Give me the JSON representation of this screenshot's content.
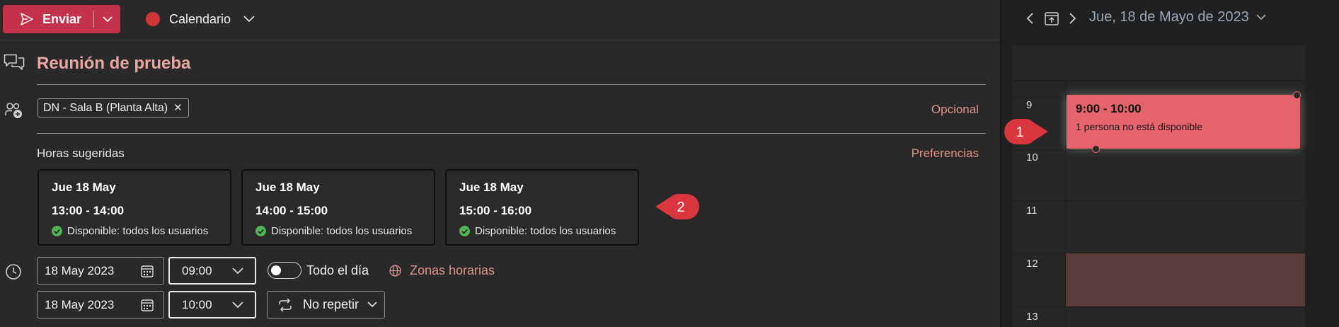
{
  "toolbar": {
    "send_label": "Enviar",
    "calendar_label": "Calendario",
    "calendar_color": "#d13438"
  },
  "form": {
    "title": "Reunión de prueba",
    "attendee_chip": "DN - Sala B (Planta Alta)",
    "optional_label": "Opcional",
    "suggested_heading": "Horas sugeridas",
    "preferences_label": "Preferencias",
    "suggestions": [
      {
        "date": "Jue 18 May",
        "time": "13:00 - 14:00",
        "availability": "Disponible: todos los usuarios"
      },
      {
        "date": "Jue 18 May",
        "time": "14:00 - 15:00",
        "availability": "Disponible: todos los usuarios"
      },
      {
        "date": "Jue 18 May",
        "time": "15:00 - 16:00",
        "availability": "Disponible: todos los usuarios"
      }
    ],
    "start_date": "18 May 2023",
    "start_time": "09:00",
    "end_date": "18 May 2023",
    "end_time": "10:00",
    "all_day_label": "Todo el día",
    "all_day_on": false,
    "timezones_label": "Zonas horarias",
    "repeat_label": "No repetir"
  },
  "callouts": {
    "one": "1",
    "two": "2"
  },
  "calendar": {
    "date_title": "Jue, 18 de Mayo de 2023",
    "hours": [
      "9",
      "10",
      "11",
      "12",
      "13"
    ],
    "event": {
      "time": "9:00 - 10:00",
      "status": "1 persona no está disponible",
      "color": "#e5636b"
    }
  },
  "colors": {
    "accent": "#c4314b",
    "link": "#e0928c",
    "available": "#4fb34f"
  }
}
